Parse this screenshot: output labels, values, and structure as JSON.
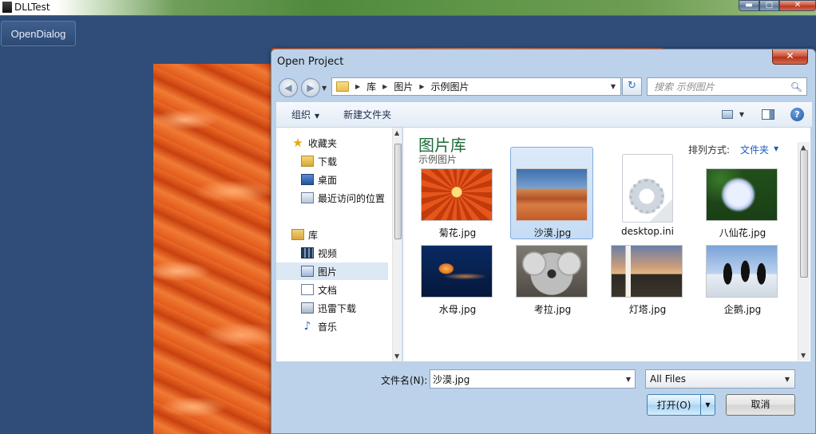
{
  "app": {
    "title": "DLLTest",
    "open_dialog_label": "OpenDialog",
    "window_controls": {
      "minimize": "▬",
      "maximize": "▢",
      "close": "✕"
    }
  },
  "dialog": {
    "title": "Open Project",
    "close_glyph": "✕",
    "breadcrumb": [
      "库",
      "图片",
      "示例图片"
    ],
    "search_placeholder": "搜索 示例图片",
    "toolbar": {
      "organize": "组织",
      "new_folder": "新建文件夹",
      "help": "?"
    },
    "nav": {
      "favorites": {
        "label": "收藏夹",
        "items": [
          "下载",
          "桌面",
          "最近访问的位置"
        ]
      },
      "libraries": {
        "label": "库",
        "items": [
          "视频",
          "图片",
          "文档",
          "迅雷下载",
          "音乐"
        ]
      },
      "selected": "图片"
    },
    "library": {
      "title": "图片库",
      "subtitle": "示例图片",
      "arrange_label": "排列方式:",
      "arrange_value": "文件夹"
    },
    "files": [
      {
        "name": "菊花.jpg",
        "thumb": "flower",
        "selected": false
      },
      {
        "name": "沙漠.jpg",
        "thumb": "desert",
        "selected": true
      },
      {
        "name": "desktop.ini",
        "thumb": "settings-file",
        "selected": false
      },
      {
        "name": "八仙花.jpg",
        "thumb": "hydrangea",
        "selected": false
      },
      {
        "name": "水母.jpg",
        "thumb": "jellyfish",
        "selected": false
      },
      {
        "name": "考拉.jpg",
        "thumb": "koala",
        "selected": false
      },
      {
        "name": "灯塔.jpg",
        "thumb": "lighthouse",
        "selected": false
      },
      {
        "name": "企鹅.jpg",
        "thumb": "penguins",
        "selected": false
      }
    ],
    "filename_label": "文件名(N):",
    "filename_value": "沙漠.jpg",
    "filter_value": "All Files",
    "open_label": "打开(O)",
    "cancel_label": "取消"
  },
  "icons": {
    "favorites": "star-icon",
    "libraries": "library-icon",
    "music": "music-note-icon",
    "search": "magnifier-icon",
    "refresh": "refresh-icon",
    "help": "help-icon"
  }
}
